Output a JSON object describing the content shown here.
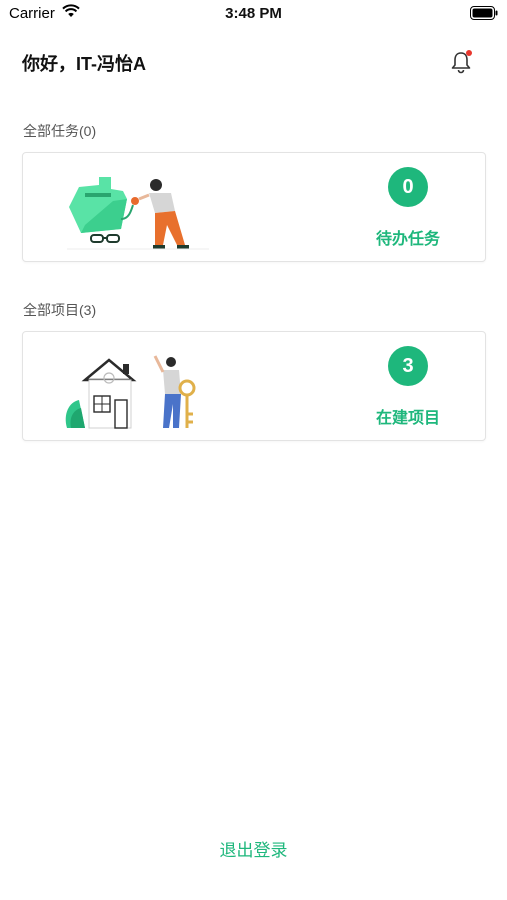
{
  "status_bar": {
    "carrier": "Carrier",
    "time": "3:48 PM"
  },
  "header": {
    "greeting": "你好，IT-冯怡A",
    "notification_dot_color": "#e8372d"
  },
  "tasks": {
    "section_title": "全部任务(0)",
    "count": "0",
    "label": "待办任务"
  },
  "projects": {
    "section_title": "全部项目(3)",
    "count": "3",
    "label": "在建项目"
  },
  "footer": {
    "logout_label": "退出登录"
  },
  "colors": {
    "accent": "#1eb77c"
  }
}
